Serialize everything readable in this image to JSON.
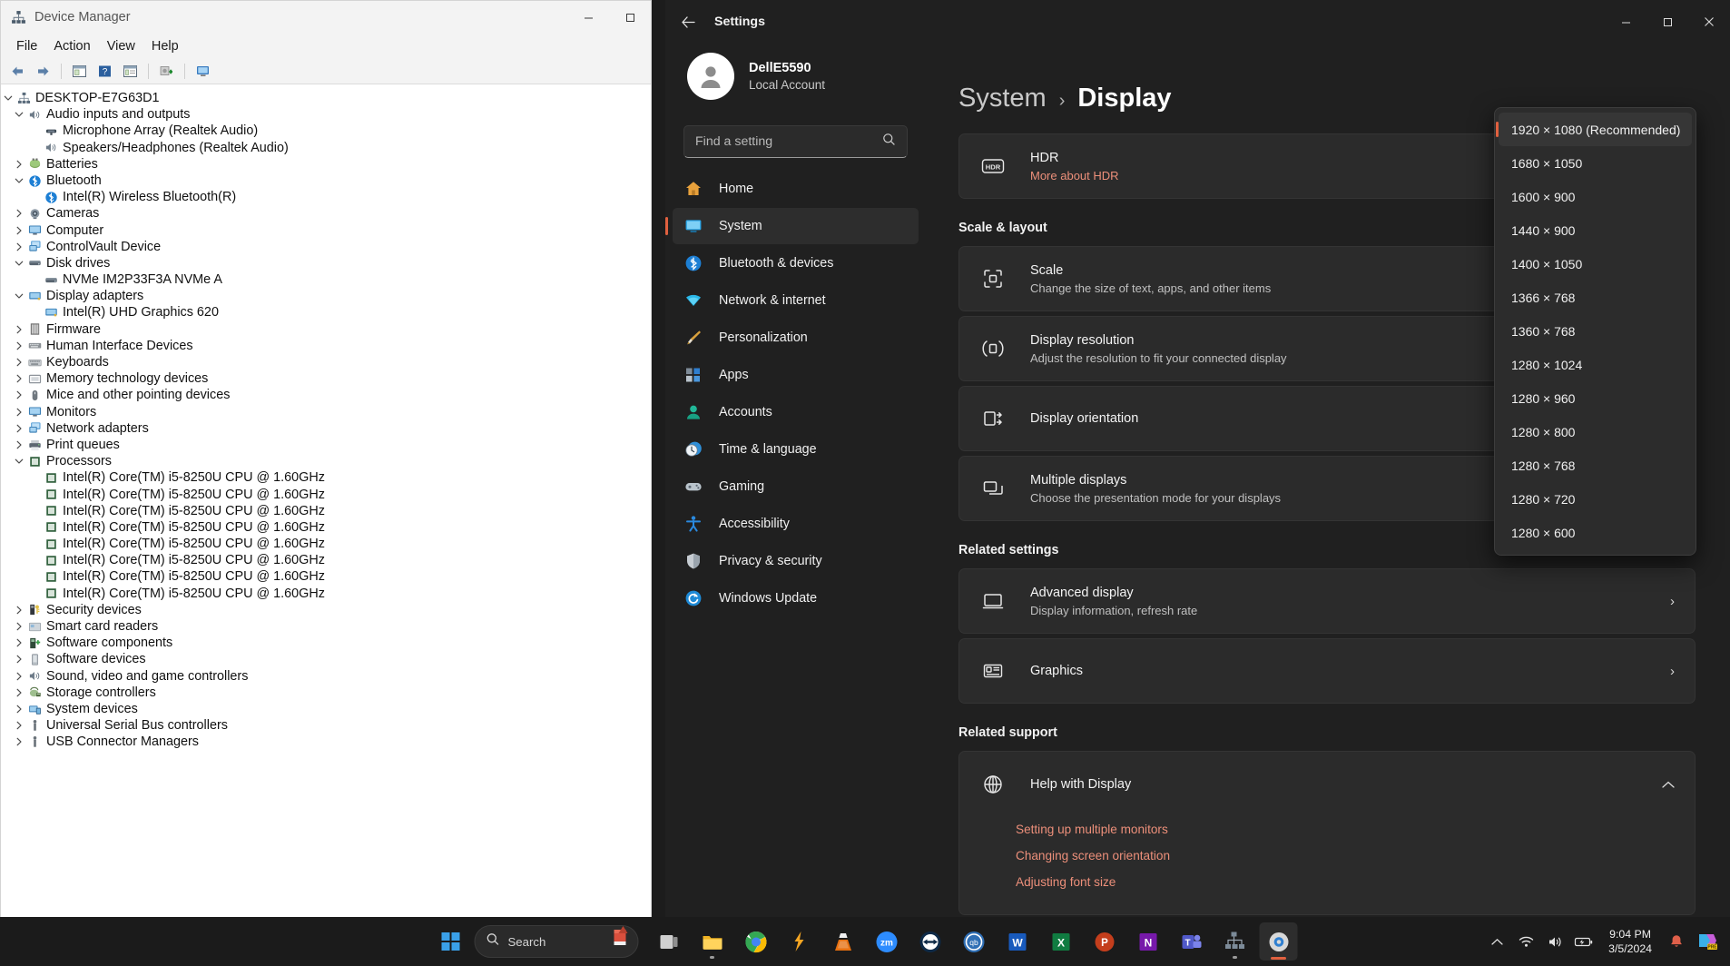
{
  "device_manager": {
    "title": "Device Manager",
    "title_icon": "device-manager-icon",
    "window_buttons": {
      "minimize": "—",
      "maximize": "☐"
    },
    "menu": [
      "File",
      "Action",
      "View",
      "Help"
    ],
    "toolbar_icons": [
      "back-arrow-icon",
      "forward-arrow-icon",
      "properties-icon",
      "help-icon",
      "show-hidden-icon",
      "update-driver-icon",
      "scan-hardware-icon"
    ],
    "tree": [
      {
        "label": "DESKTOP-E7G63D1",
        "depth": 0,
        "state": "expanded",
        "icon": "computer-node-icon"
      },
      {
        "label": "Audio inputs and outputs",
        "depth": 1,
        "state": "expanded",
        "icon": "speaker-icon"
      },
      {
        "label": "Microphone Array (Realtek Audio)",
        "depth": 2,
        "state": "leaf",
        "icon": "microphone-icon"
      },
      {
        "label": "Speakers/Headphones (Realtek Audio)",
        "depth": 2,
        "state": "leaf",
        "icon": "speaker-icon"
      },
      {
        "label": "Batteries",
        "depth": 1,
        "state": "collapsed",
        "icon": "battery-icon"
      },
      {
        "label": "Bluetooth",
        "depth": 1,
        "state": "expanded",
        "icon": "bluetooth-icon"
      },
      {
        "label": "Intel(R) Wireless Bluetooth(R)",
        "depth": 2,
        "state": "leaf",
        "icon": "bluetooth-icon"
      },
      {
        "label": "Cameras",
        "depth": 1,
        "state": "collapsed",
        "icon": "camera-icon"
      },
      {
        "label": "Computer",
        "depth": 1,
        "state": "collapsed",
        "icon": "monitor-icon"
      },
      {
        "label": "ControlVault Device",
        "depth": 1,
        "state": "collapsed",
        "icon": "network-device-icon"
      },
      {
        "label": "Disk drives",
        "depth": 1,
        "state": "expanded",
        "icon": "disk-icon"
      },
      {
        "label": "NVMe IM2P33F3A NVMe A",
        "depth": 2,
        "state": "leaf",
        "icon": "disk-icon"
      },
      {
        "label": "Display adapters",
        "depth": 1,
        "state": "expanded",
        "icon": "display-adapter-icon"
      },
      {
        "label": "Intel(R) UHD Graphics 620",
        "depth": 2,
        "state": "leaf",
        "icon": "display-adapter-icon"
      },
      {
        "label": "Firmware",
        "depth": 1,
        "state": "collapsed",
        "icon": "firmware-icon"
      },
      {
        "label": "Human Interface Devices",
        "depth": 1,
        "state": "collapsed",
        "icon": "hid-icon"
      },
      {
        "label": "Keyboards",
        "depth": 1,
        "state": "collapsed",
        "icon": "keyboard-icon"
      },
      {
        "label": "Memory technology devices",
        "depth": 1,
        "state": "collapsed",
        "icon": "memory-icon"
      },
      {
        "label": "Mice and other pointing devices",
        "depth": 1,
        "state": "collapsed",
        "icon": "mouse-icon"
      },
      {
        "label": "Monitors",
        "depth": 1,
        "state": "collapsed",
        "icon": "monitor-icon"
      },
      {
        "label": "Network adapters",
        "depth": 1,
        "state": "collapsed",
        "icon": "network-device-icon"
      },
      {
        "label": "Print queues",
        "depth": 1,
        "state": "collapsed",
        "icon": "printer-icon"
      },
      {
        "label": "Processors",
        "depth": 1,
        "state": "expanded",
        "icon": "cpu-icon"
      },
      {
        "label": "Intel(R) Core(TM) i5-8250U CPU @ 1.60GHz",
        "depth": 2,
        "state": "leaf",
        "icon": "cpu-icon"
      },
      {
        "label": "Intel(R) Core(TM) i5-8250U CPU @ 1.60GHz",
        "depth": 2,
        "state": "leaf",
        "icon": "cpu-icon"
      },
      {
        "label": "Intel(R) Core(TM) i5-8250U CPU @ 1.60GHz",
        "depth": 2,
        "state": "leaf",
        "icon": "cpu-icon"
      },
      {
        "label": "Intel(R) Core(TM) i5-8250U CPU @ 1.60GHz",
        "depth": 2,
        "state": "leaf",
        "icon": "cpu-icon"
      },
      {
        "label": "Intel(R) Core(TM) i5-8250U CPU @ 1.60GHz",
        "depth": 2,
        "state": "leaf",
        "icon": "cpu-icon"
      },
      {
        "label": "Intel(R) Core(TM) i5-8250U CPU @ 1.60GHz",
        "depth": 2,
        "state": "leaf",
        "icon": "cpu-icon"
      },
      {
        "label": "Intel(R) Core(TM) i5-8250U CPU @ 1.60GHz",
        "depth": 2,
        "state": "leaf",
        "icon": "cpu-icon"
      },
      {
        "label": "Intel(R) Core(TM) i5-8250U CPU @ 1.60GHz",
        "depth": 2,
        "state": "leaf",
        "icon": "cpu-icon"
      },
      {
        "label": "Security devices",
        "depth": 1,
        "state": "collapsed",
        "icon": "security-icon"
      },
      {
        "label": "Smart card readers",
        "depth": 1,
        "state": "collapsed",
        "icon": "smartcard-icon"
      },
      {
        "label": "Software components",
        "depth": 1,
        "state": "collapsed",
        "icon": "software-component-icon"
      },
      {
        "label": "Software devices",
        "depth": 1,
        "state": "collapsed",
        "icon": "software-device-icon"
      },
      {
        "label": "Sound, video and game controllers",
        "depth": 1,
        "state": "collapsed",
        "icon": "speaker-icon"
      },
      {
        "label": "Storage controllers",
        "depth": 1,
        "state": "collapsed",
        "icon": "storage-controller-icon"
      },
      {
        "label": "System devices",
        "depth": 1,
        "state": "collapsed",
        "icon": "system-device-icon"
      },
      {
        "label": "Universal Serial Bus controllers",
        "depth": 1,
        "state": "collapsed",
        "icon": "usb-icon"
      },
      {
        "label": "USB Connector Managers",
        "depth": 1,
        "state": "collapsed",
        "icon": "usb-icon"
      }
    ]
  },
  "settings": {
    "window_title": "Settings",
    "back_icon": "back-arrow-icon",
    "window_buttons": {
      "minimize": "—",
      "maximize": "☐",
      "close": "✕"
    },
    "account": {
      "name": "DellE5590",
      "type": "Local Account",
      "avatar_icon": "person-avatar-icon"
    },
    "search": {
      "placeholder": "Find a setting",
      "icon": "search-icon"
    },
    "nav": [
      {
        "label": "Home",
        "icon": "home-icon",
        "active": false
      },
      {
        "label": "System",
        "icon": "system-icon",
        "active": true
      },
      {
        "label": "Bluetooth & devices",
        "icon": "bluetooth-icon",
        "active": false
      },
      {
        "label": "Network & internet",
        "icon": "wifi-icon",
        "active": false
      },
      {
        "label": "Personalization",
        "icon": "paintbrush-icon",
        "active": false
      },
      {
        "label": "Apps",
        "icon": "apps-icon",
        "active": false
      },
      {
        "label": "Accounts",
        "icon": "accounts-icon",
        "active": false
      },
      {
        "label": "Time & language",
        "icon": "clock-globe-icon",
        "active": false
      },
      {
        "label": "Gaming",
        "icon": "gamepad-icon",
        "active": false
      },
      {
        "label": "Accessibility",
        "icon": "accessibility-icon",
        "active": false
      },
      {
        "label": "Privacy & security",
        "icon": "shield-icon",
        "active": false
      },
      {
        "label": "Windows Update",
        "icon": "windows-update-icon",
        "active": false
      }
    ],
    "breadcrumb": {
      "parent": "System",
      "separator": "›",
      "current": "Display"
    },
    "cards": {
      "hdr": {
        "title": "HDR",
        "link": "More about HDR",
        "icon": "hdr-icon"
      },
      "scale": {
        "title": "Scale",
        "sub": "Change the size of text, apps, and other items",
        "icon": "scale-icon"
      },
      "resolution": {
        "title": "Display resolution",
        "sub": "Adjust the resolution to fit your connected display",
        "icon": "resolution-icon"
      },
      "orientation": {
        "title": "Display orientation",
        "sub": "",
        "icon": "orientation-icon"
      },
      "multiple": {
        "title": "Multiple displays",
        "sub": "Choose the presentation mode for your displays",
        "icon": "multiple-displays-icon"
      },
      "advanced": {
        "title": "Advanced display",
        "sub": "Display information, refresh rate",
        "icon": "advanced-display-icon",
        "chevron": "›"
      },
      "graphics": {
        "title": "Graphics",
        "sub": "",
        "icon": "graphics-icon",
        "chevron": "›"
      },
      "help": {
        "title": "Help with Display",
        "icon": "globe-help-icon",
        "chevron": "⌃"
      }
    },
    "section_headings": {
      "scale_layout": "Scale & layout",
      "related_settings": "Related settings",
      "related_support": "Related support"
    },
    "support_links": [
      "Setting up multiple monitors",
      "Changing screen orientation",
      "Adjusting font size"
    ],
    "resolution_dropdown": {
      "options": [
        {
          "label": "1920 × 1080 (Recommended)",
          "selected": true
        },
        {
          "label": "1680 × 1050",
          "selected": false
        },
        {
          "label": "1600 × 900",
          "selected": false
        },
        {
          "label": "1440 × 900",
          "selected": false
        },
        {
          "label": "1400 × 1050",
          "selected": false
        },
        {
          "label": "1366 × 768",
          "selected": false
        },
        {
          "label": "1360 × 768",
          "selected": false
        },
        {
          "label": "1280 × 1024",
          "selected": false
        },
        {
          "label": "1280 × 960",
          "selected": false
        },
        {
          "label": "1280 × 800",
          "selected": false
        },
        {
          "label": "1280 × 768",
          "selected": false
        },
        {
          "label": "1280 × 720",
          "selected": false
        },
        {
          "label": "1280 × 600",
          "selected": false
        }
      ]
    },
    "accent_color": "#e0603f"
  },
  "taskbar": {
    "start_icon": "windows-start-icon",
    "search": {
      "label": "Search",
      "icon": "search-icon"
    },
    "apps": [
      {
        "name": "task-view-icon",
        "running": false
      },
      {
        "name": "file-explorer-icon",
        "running": true
      },
      {
        "name": "google-chrome-icon",
        "running": false
      },
      {
        "name": "firefox-dev-icon",
        "running": false
      },
      {
        "name": "vlc-media-player-icon",
        "running": false
      },
      {
        "name": "zoom-icon",
        "running": false
      },
      {
        "name": "teamviewer-icon",
        "running": false
      },
      {
        "name": "qbittorrent-icon",
        "running": false
      },
      {
        "name": "microsoft-word-icon",
        "running": false
      },
      {
        "name": "microsoft-excel-icon",
        "running": false
      },
      {
        "name": "microsoft-powerpoint-icon",
        "running": false
      },
      {
        "name": "microsoft-onenote-icon",
        "running": false
      },
      {
        "name": "microsoft-teams-icon",
        "running": false
      },
      {
        "name": "device-manager-taskbar-icon",
        "running": true
      },
      {
        "name": "settings-gear-icon",
        "running": true
      }
    ],
    "tray": {
      "chevron_icon": "show-hidden-icons-chevron",
      "wifi_icon": "wifi-icon",
      "volume_icon": "volume-icon",
      "battery_icon": "battery-charging-icon",
      "time": "9:04 PM",
      "date": "3/5/2024",
      "notification_icon": "notification-bell-icon",
      "pre_icon": "copilot-pre-icon"
    }
  }
}
